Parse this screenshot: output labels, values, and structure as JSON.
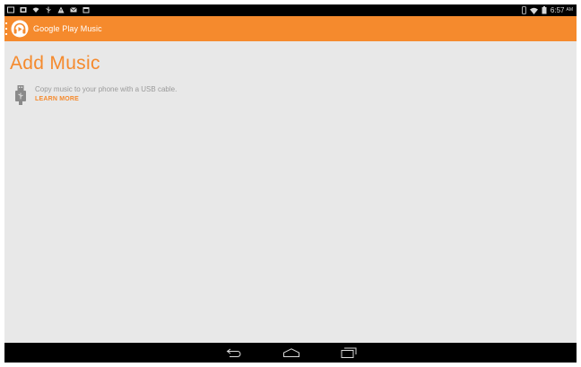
{
  "status_bar": {
    "time": "6:57",
    "ampm": "AM",
    "left_icons": [
      "screenshot-icon",
      "gallery-icon",
      "wifi-notify-icon",
      "usb-icon",
      "warning-icon",
      "mail-icon",
      "calendar-icon"
    ],
    "right_icons": [
      "vibrate-icon",
      "wifi-signal-icon",
      "battery-icon"
    ]
  },
  "action_bar": {
    "title": "Google Play Music",
    "icon": "headphones-icon",
    "color": "#f58a2d"
  },
  "main": {
    "heading": "Add Music",
    "usb_instruction": "Copy music to your phone with a USB cable.",
    "learn_more_label": "LEARN MORE",
    "accent": "#f58a2d",
    "background": "#e8e8e8"
  },
  "nav_bar": {
    "buttons": [
      "back-icon",
      "home-icon",
      "recents-icon"
    ]
  }
}
